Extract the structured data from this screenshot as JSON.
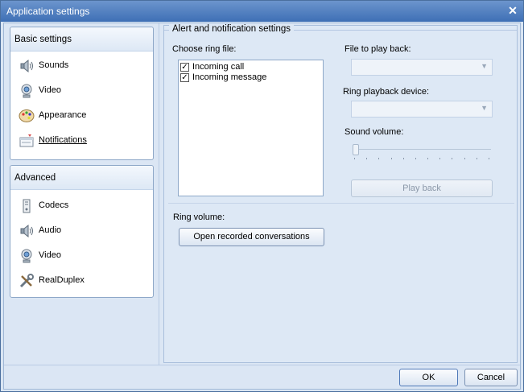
{
  "window": {
    "title": "Application settings"
  },
  "nav": {
    "groups": [
      {
        "heading": "Basic settings",
        "items": [
          {
            "label": "Sounds",
            "icon": "speaker-icon"
          },
          {
            "label": "Video",
            "icon": "webcam-icon"
          },
          {
            "label": "Appearance",
            "icon": "palette-icon"
          },
          {
            "label": "Notifications",
            "icon": "notification-icon",
            "active": true
          }
        ]
      },
      {
        "heading": "Advanced",
        "items": [
          {
            "label": "Codecs",
            "icon": "codec-icon"
          },
          {
            "label": "Audio",
            "icon": "speaker-icon"
          },
          {
            "label": "Video",
            "icon": "webcam-icon"
          },
          {
            "label": "RealDuplex",
            "icon": "tools-icon"
          }
        ]
      }
    ]
  },
  "panel": {
    "title": "Alert and notification settings",
    "choose_ring_label": "Choose ring file:",
    "ring_files": [
      {
        "label": "Incoming call",
        "checked": true
      },
      {
        "label": "Incoming message",
        "checked": true
      }
    ],
    "file_to_play_label": "File to play back:",
    "file_to_play_value": "",
    "ring_device_label": "Ring playback device:",
    "ring_device_value": "",
    "sound_volume_label": "Sound volume:",
    "sound_volume_level": 0,
    "play_back_label": "Play back",
    "ring_volume_label": "Ring volume:",
    "open_recorded_label": "Open recorded conversations"
  },
  "footer": {
    "ok_label": "OK",
    "cancel_label": "Cancel"
  }
}
